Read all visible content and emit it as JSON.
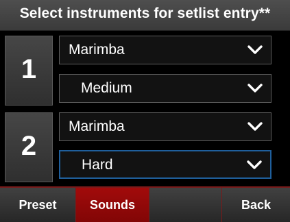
{
  "title": "Select instruments for setlist entry**",
  "entries": [
    {
      "number": "1",
      "instrument": "Marimba",
      "difficulty": "Medium"
    },
    {
      "number": "2",
      "instrument": "Marimba",
      "difficulty": "Hard"
    }
  ],
  "nav": {
    "preset": "Preset",
    "sounds": "Sounds",
    "blank": "",
    "back": "Back"
  },
  "colors": {
    "accent_red": "#a10b0b",
    "focus_blue": "#1f5f9c"
  },
  "icons": {
    "dropdown": "chevron-down-icon"
  }
}
